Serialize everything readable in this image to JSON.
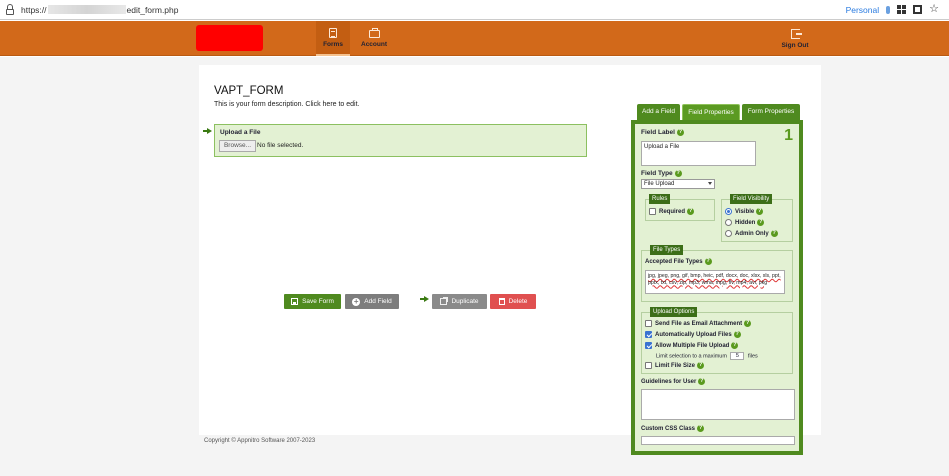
{
  "browser": {
    "url_prefix": "https://",
    "url_suffix": "edit_form.php",
    "profile": "Personal"
  },
  "nav": {
    "forms": "Forms",
    "account": "Account",
    "signout": "Sign Out"
  },
  "form": {
    "title": "VAPT_FORM",
    "description": "This is your form description. Click here to edit."
  },
  "field": {
    "label": "Upload a File",
    "browse": "Browse...",
    "no_file": "No file selected."
  },
  "actions": {
    "save": "Save Form",
    "add": "Add Field",
    "duplicate": "Duplicate",
    "delete": "Delete"
  },
  "tabs": [
    "Add a Field",
    "Field Properties",
    "Form Properties"
  ],
  "panel": {
    "number": "1",
    "field_label_title": "Field Label",
    "field_label_value": "Upload a File",
    "field_type_title": "Field Type",
    "field_type_value": "File Upload",
    "rules_legend": "Rules",
    "required": "Required",
    "visibility_legend": "Field Visibility",
    "visible": "Visible",
    "hidden": "Hidden",
    "admin_only": "Admin Only",
    "file_types_legend": "File Types",
    "accepted_title": "Accepted File Types",
    "accepted_value": "jpg, jpeg, png, gif, bmp, heic, pdf, docx, doc, xlsx, xls, ppt, pptx, txt, csv, zip, mp3, wma, mpg, flv, mp4, avi, pkg",
    "upload_legend": "Upload Options",
    "send_email": "Send File as Email Attachment",
    "auto_upload": "Automatically Upload Files",
    "multi_upload": "Allow Multiple File Upload",
    "limit_prefix": "Limit selection to a maximum",
    "limit_value": "5",
    "limit_suffix": "files",
    "limit_size": "Limit File Size",
    "guidelines_title": "Guidelines for User",
    "css_title": "Custom CSS Class"
  },
  "footer": "Copyright © Appnitro Software 2007-2023"
}
